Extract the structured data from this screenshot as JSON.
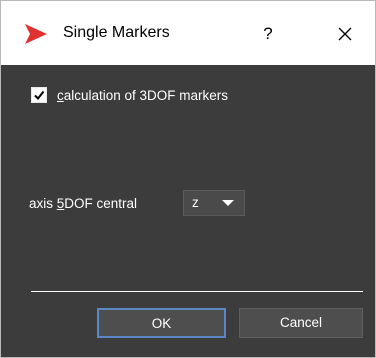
{
  "window": {
    "title": "Single Markers",
    "help_label": "?",
    "accent_color": "#5b87c7",
    "icon_color": "#e0322e"
  },
  "options": {
    "calc_3dof": {
      "checked": true,
      "label_prefix": "c",
      "label_rest": "alculation of 3DOF markers"
    },
    "axis_5dof": {
      "label_pre": "axis ",
      "label_ul": "5",
      "label_post": "DOF central",
      "value": "z"
    }
  },
  "buttons": {
    "ok": "OK",
    "cancel": "Cancel"
  }
}
